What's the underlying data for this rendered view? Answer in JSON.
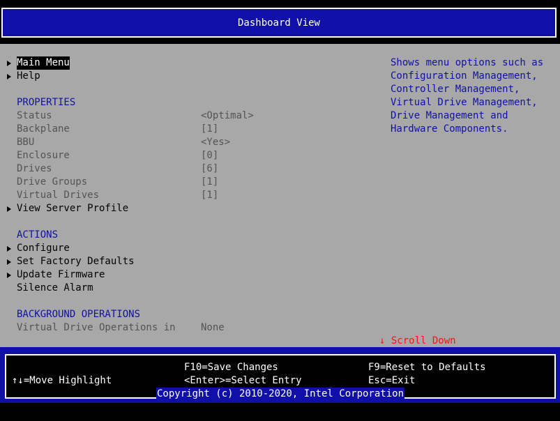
{
  "header": {
    "title": "Dashboard View"
  },
  "menu": {
    "main_menu": "Main Menu",
    "help": "Help"
  },
  "properties": {
    "heading": "PROPERTIES",
    "rows": [
      {
        "label": "Status",
        "value": "<Optimal>"
      },
      {
        "label": "Backplane",
        "value": "[1]"
      },
      {
        "label": "BBU",
        "value": "<Yes>"
      },
      {
        "label": "Enclosure",
        "value": "[0]"
      },
      {
        "label": "Drives",
        "value": "[6]"
      },
      {
        "label": "Drive Groups",
        "value": "[1]"
      },
      {
        "label": "Virtual Drives",
        "value": "[1]"
      }
    ],
    "view_server_profile": "View Server Profile"
  },
  "actions": {
    "heading": "ACTIONS",
    "configure": "Configure",
    "set_factory_defaults": "Set Factory Defaults",
    "update_firmware": "Update Firmware",
    "silence_alarm": "Silence Alarm"
  },
  "background_operations": {
    "heading": "BACKGROUND OPERATIONS",
    "label": "Virtual Drive Operations in",
    "value": "None"
  },
  "help_panel": {
    "lines": [
      "Shows menu options such as",
      "Configuration Management,",
      "Controller Management,",
      "Virtual Drive Management,",
      "Drive Management and",
      "Hardware Components."
    ]
  },
  "scroll": {
    "label": "↓ Scroll Down"
  },
  "footer": {
    "move_highlight": "↑↓=Move Highlight",
    "save_changes": "F10=Save Changes",
    "select_entry": "<Enter>=Select Entry",
    "reset_defaults": "F9=Reset to Defaults",
    "exit": "Esc=Exit",
    "copyright": "Copyright (c) 2010-2020, Intel Corporation"
  },
  "colors": {
    "bios_blue": "#1010a8",
    "panel_gray": "#a8a8a8",
    "disabled_gray": "#545454",
    "scroll_red": "#ff1010"
  }
}
